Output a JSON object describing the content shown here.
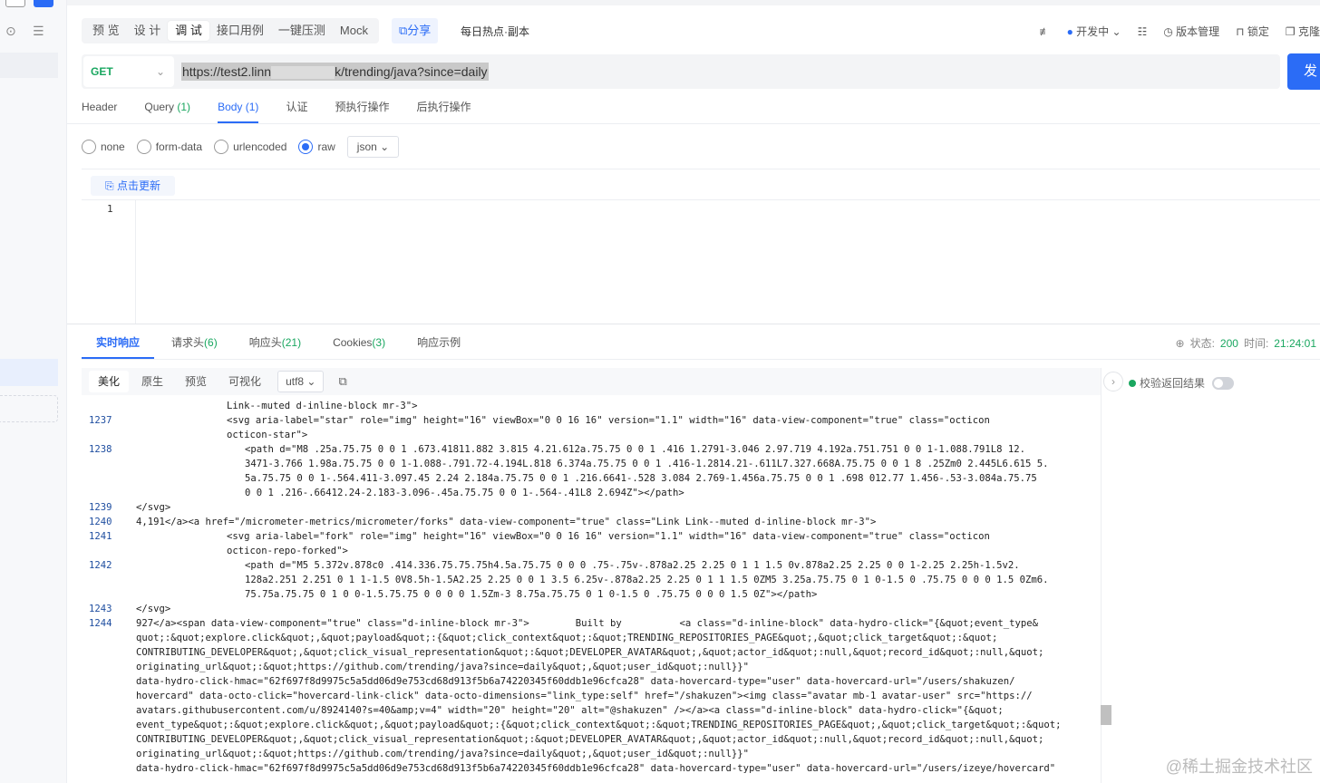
{
  "toolbar": {
    "mode_tabs": [
      "预 览",
      "设 计",
      "调 试",
      "接口用例",
      "一键压测",
      "Mock"
    ],
    "active_mode_index": 2,
    "share_label": "分享",
    "doc_name": "每日热点·副本",
    "env_label": "开发中",
    "version_label": "版本管理",
    "lock_label": "锁定",
    "clone_label": "克隆"
  },
  "request": {
    "method": "GET",
    "url_start": "https://test2.linn",
    "url_end": "k/trending/java?since=daily",
    "send_label": "发"
  },
  "req_tabs": [
    {
      "label": "Header",
      "count": ""
    },
    {
      "label": "Query",
      "count": "(1)"
    },
    {
      "label": "Body",
      "count": "(1)"
    },
    {
      "label": "认证",
      "count": ""
    },
    {
      "label": "预执行操作",
      "count": ""
    },
    {
      "label": "后执行操作",
      "count": ""
    }
  ],
  "body_options": [
    "none",
    "form-data",
    "urlencoded",
    "raw"
  ],
  "body_selected": "raw",
  "body_format": "json",
  "update_label": "点击更新",
  "editor_line": "1",
  "resp_tabs": [
    {
      "label": "实时响应",
      "count": ""
    },
    {
      "label": "请求头",
      "count": "(6)"
    },
    {
      "label": "响应头",
      "count": "(21)"
    },
    {
      "label": "Cookies",
      "count": "(3)"
    },
    {
      "label": "响应示例",
      "count": ""
    }
  ],
  "status": {
    "status_label": "状态:",
    "status_code": "200",
    "time_label": "时间:",
    "time_value": "21:24:01"
  },
  "format_buttons": [
    "美化",
    "原生",
    "预览",
    "可视化"
  ],
  "encoding": "utf8",
  "validate_label": "校验返回结果",
  "code_lines": [
    {
      "no": "",
      "indent": 10,
      "text": "Link--muted d-inline-block mr-3\">"
    },
    {
      "no": "1237",
      "indent": 10,
      "text": "<svg aria-label=\"star\" role=\"img\" height=\"16\" viewBox=\"0 0 16 16\" version=\"1.1\" width=\"16\" data-view-component=\"true\" class=\"octicon"
    },
    {
      "no": "",
      "indent": 10,
      "text": "octicon-star\">"
    },
    {
      "no": "1238",
      "indent": 12,
      "text": "<path d=\"M8 .25a.75.75 0 0 1 .673.41811.882 3.815 4.21.612a.75.75 0 0 1 .416 1.2791-3.046 2.97.719 4.192a.751.751 0 0 1-1.088.791L8 12."
    },
    {
      "no": "",
      "indent": 12,
      "text": "3471-3.766 1.98a.75.75 0 0 1-1.088-.791.72-4.194L.818 6.374a.75.75 0 0 1 .416-1.2814.21-.611L7.327.668A.75.75 0 0 1 8 .25Zm0 2.445L6.615 5."
    },
    {
      "no": "",
      "indent": 12,
      "text": "5a.75.75 0 0 1-.564.411-3.097.45 2.24 2.184a.75.75 0 0 1 .216.6641-.528 3.084 2.769-1.456a.75.75 0 0 1 .698 012.77 1.456-.53-3.084a.75.75"
    },
    {
      "no": "",
      "indent": 12,
      "text": "0 0 1 .216-.66412.24-2.183-3.096-.45a.75.75 0 0 1-.564-.41L8 2.694Z\"></path>"
    },
    {
      "no": "1239",
      "indent": 0,
      "text": "</svg>"
    },
    {
      "no": "1240",
      "indent": 0,
      "text": "4,191</a><a href=\"/micrometer-metrics/micrometer/forks\" data-view-component=\"true\" class=\"Link Link--muted d-inline-block mr-3\">"
    },
    {
      "no": "1241",
      "indent": 10,
      "text": "<svg aria-label=\"fork\" role=\"img\" height=\"16\" viewBox=\"0 0 16 16\" version=\"1.1\" width=\"16\" data-view-component=\"true\" class=\"octicon"
    },
    {
      "no": "",
      "indent": 10,
      "text": "octicon-repo-forked\">"
    },
    {
      "no": "1242",
      "indent": 12,
      "text": "<path d=\"M5 5.372v.878c0 .414.336.75.75.75h4.5a.75.75 0 0 0 .75-.75v-.878a2.25 2.25 0 1 1 1.5 0v.878a2.25 2.25 0 0 1-2.25 2.25h-1.5v2."
    },
    {
      "no": "",
      "indent": 12,
      "text": "128a2.251 2.251 0 1 1-1.5 0V8.5h-1.5A2.25 2.25 0 0 1 3.5 6.25v-.878a2.25 2.25 0 1 1 1.5 0ZM5 3.25a.75.75 0 1 0-1.5 0 .75.75 0 0 0 1.5 0Zm6."
    },
    {
      "no": "",
      "indent": 12,
      "text": "75.75a.75.75 0 1 0 0-1.5.75.75 0 0 0 0 1.5Zm-3 8.75a.75.75 0 1 0-1.5 0 .75.75 0 0 0 1.5 0Z\"></path>"
    },
    {
      "no": "1243",
      "indent": 0,
      "text": "</svg>"
    },
    {
      "no": "1244",
      "indent": 0,
      "text": "927</a><span data-view-component=\"true\" class=\"d-inline-block mr-3\">        Built by          <a class=\"d-inline-block\" data-hydro-click=\"{&quot;event_type&"
    },
    {
      "no": "",
      "indent": 0,
      "text": "quot;:&quot;explore.click&quot;,&quot;payload&quot;:{&quot;click_context&quot;:&quot;TRENDING_REPOSITORIES_PAGE&quot;,&quot;click_target&quot;:&quot;"
    },
    {
      "no": "",
      "indent": 0,
      "text": "CONTRIBUTING_DEVELOPER&quot;,&quot;click_visual_representation&quot;:&quot;DEVELOPER_AVATAR&quot;,&quot;actor_id&quot;:null,&quot;record_id&quot;:null,&quot;"
    },
    {
      "no": "",
      "indent": 0,
      "text": "originating_url&quot;:&quot;https://github.com/trending/java?since=daily&quot;,&quot;user_id&quot;:null}}\""
    },
    {
      "no": "",
      "indent": 0,
      "text": "data-hydro-click-hmac=\"62f697f8d9975c5a5dd06d9e753cd68d913f5b6a74220345f60ddb1e96cfca28\" data-hovercard-type=\"user\" data-hovercard-url=\"/users/shakuzen/"
    },
    {
      "no": "",
      "indent": 0,
      "text": "hovercard\" data-octo-click=\"hovercard-link-click\" data-octo-dimensions=\"link_type:self\" href=\"/shakuzen\"><img class=\"avatar mb-1 avatar-user\" src=\"https://"
    },
    {
      "no": "",
      "indent": 0,
      "text": "avatars.githubusercontent.com/u/8924140?s=40&amp;v=4\" width=\"20\" height=\"20\" alt=\"@shakuzen\" /></a><a class=\"d-inline-block\" data-hydro-click=\"{&quot;"
    },
    {
      "no": "",
      "indent": 0,
      "text": "event_type&quot;:&quot;explore.click&quot;,&quot;payload&quot;:{&quot;click_context&quot;:&quot;TRENDING_REPOSITORIES_PAGE&quot;,&quot;click_target&quot;:&quot;"
    },
    {
      "no": "",
      "indent": 0,
      "text": "CONTRIBUTING_DEVELOPER&quot;,&quot;click_visual_representation&quot;:&quot;DEVELOPER_AVATAR&quot;,&quot;actor_id&quot;:null,&quot;record_id&quot;:null,&quot;"
    },
    {
      "no": "",
      "indent": 0,
      "text": "originating_url&quot;:&quot;https://github.com/trending/java?since=daily&quot;,&quot;user_id&quot;:null}}\""
    },
    {
      "no": "",
      "indent": 0,
      "text": "data-hydro-click-hmac=\"62f697f8d9975c5a5dd06d9e753cd68d913f5b6a74220345f60ddb1e96cfca28\" data-hovercard-type=\"user\" data-hovercard-url=\"/users/izeye/hovercard\""
    }
  ],
  "watermark": "@稀土掘金技术社区",
  "colors": {
    "accent": "#2b6cf6",
    "success": "#1aa760"
  }
}
